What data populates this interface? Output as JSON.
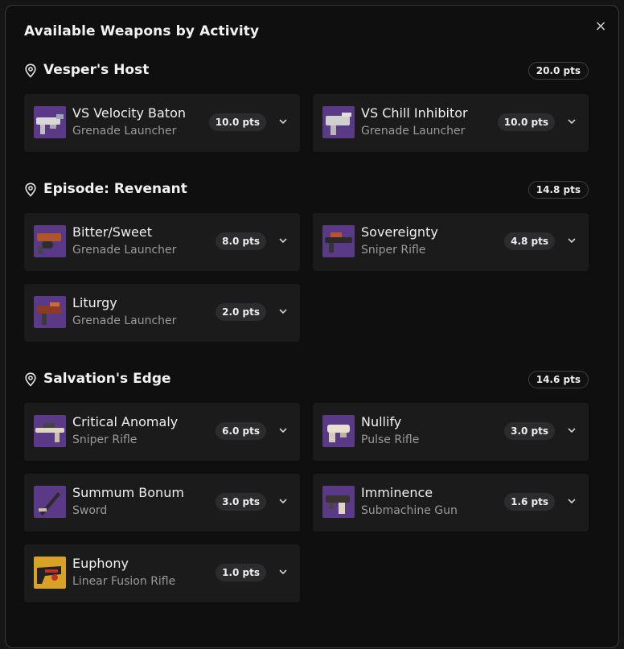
{
  "dialog": {
    "title": "Available Weapons by Activity",
    "close_glyph": "×"
  },
  "icons": {
    "section": "location-pin-icon",
    "expand": "chevron-down-icon",
    "close": "close-icon"
  },
  "sections": [
    {
      "name": "Vesper's Host",
      "total": "20.0 pts",
      "weapons": [
        {
          "name": "VS Velocity Baton",
          "type": "Grenade Launcher",
          "pts": "10.0 pts"
        },
        {
          "name": "VS Chill Inhibitor",
          "type": "Grenade Launcher",
          "pts": "10.0 pts"
        }
      ]
    },
    {
      "name": "Episode: Revenant",
      "total": "14.8 pts",
      "weapons": [
        {
          "name": "Bitter/Sweet",
          "type": "Grenade Launcher",
          "pts": "8.0 pts"
        },
        {
          "name": "Sovereignty",
          "type": "Sniper Rifle",
          "pts": "4.8 pts"
        },
        {
          "name": "Liturgy",
          "type": "Grenade Launcher",
          "pts": "2.0 pts"
        }
      ]
    },
    {
      "name": "Salvation's Edge",
      "total": "14.6 pts",
      "weapons": [
        {
          "name": "Critical Anomaly",
          "type": "Sniper Rifle",
          "pts": "6.0 pts"
        },
        {
          "name": "Nullify",
          "type": "Pulse Rifle",
          "pts": "3.0 pts"
        },
        {
          "name": "Summum Bonum",
          "type": "Sword",
          "pts": "3.0 pts"
        },
        {
          "name": "Imminence",
          "type": "Submachine Gun",
          "pts": "1.6 pts"
        },
        {
          "name": "Euphony",
          "type": "Linear Fusion Rifle",
          "pts": "1.0 pts"
        }
      ]
    }
  ],
  "colors": {
    "legendary_thumb": "#5a3a86",
    "exotic_thumb": "#d8a324",
    "card_bg": "#1b1b1c",
    "modal_bg": "#0f0f10"
  }
}
